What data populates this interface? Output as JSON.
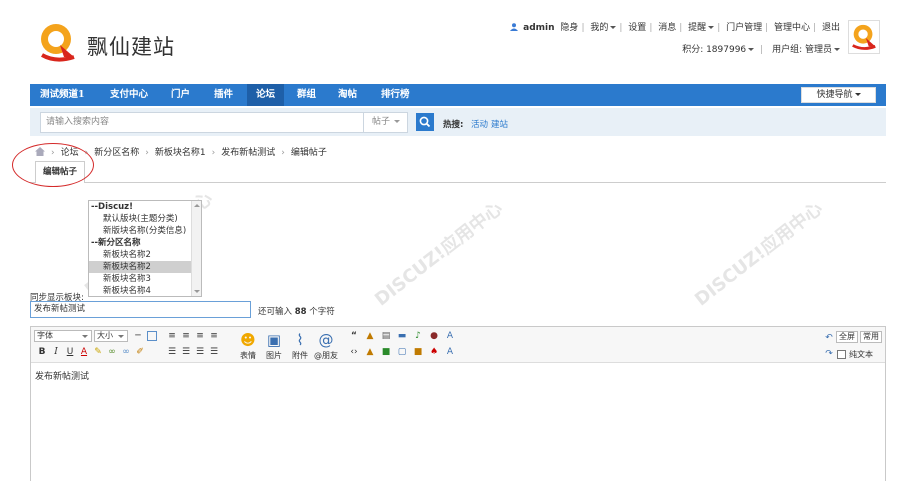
{
  "site": {
    "logo_text": "飘仙建站"
  },
  "user_bar": {
    "username": "admin",
    "links": [
      "隐身",
      "我的",
      "设置",
      "消息",
      "提醒",
      "门户管理",
      "管理中心",
      "退出"
    ],
    "points_label": "积分: 1897996",
    "group_label": "用户组: 管理员"
  },
  "nav": {
    "items": [
      "测试频道1",
      "支付中心",
      "门户",
      "插件",
      "论坛",
      "群组",
      "淘帖",
      "排行榜"
    ],
    "active_index": 4,
    "quick_nav": "快捷导航",
    "colors": {
      "bar": "#2b7acd",
      "active": "#1e5fa8"
    }
  },
  "search": {
    "placeholder": "请输入搜索内容",
    "type": "帖子",
    "hot_label": "热搜:",
    "hot_items": [
      "活动",
      "建站"
    ]
  },
  "breadcrumb": [
    "论坛",
    "新分区名称",
    "新板块名称1",
    "发布新帖测试",
    "编辑帖子"
  ],
  "tab": {
    "label": "编辑帖子"
  },
  "forum_select": {
    "options": [
      {
        "label": "--Discuz!",
        "kind": "group"
      },
      {
        "label": "默认版块(主题分类)",
        "kind": "child"
      },
      {
        "label": "新版块名称(分类信息)",
        "kind": "child"
      },
      {
        "label": "--新分区名称",
        "kind": "group"
      },
      {
        "label": "新板块名称2",
        "kind": "child"
      },
      {
        "label": "新板块名称2",
        "kind": "child",
        "selected": true
      },
      {
        "label": "新板块名称3",
        "kind": "child"
      },
      {
        "label": "新板块名称4",
        "kind": "child"
      }
    ],
    "sync_label": "同步显示板块:"
  },
  "title": {
    "value": "发布新帖测试",
    "remain_prefix": "还可输入",
    "remain_count": "88",
    "remain_suffix": "个字符"
  },
  "editor": {
    "font_label": "字体",
    "size_label": "大小",
    "big_buttons": [
      "表情",
      "图片",
      "附件",
      "@朋友"
    ],
    "fullscreen": "全屏",
    "common": "常用",
    "plain_text": "纯文本",
    "content": "发布新帖测试"
  }
}
